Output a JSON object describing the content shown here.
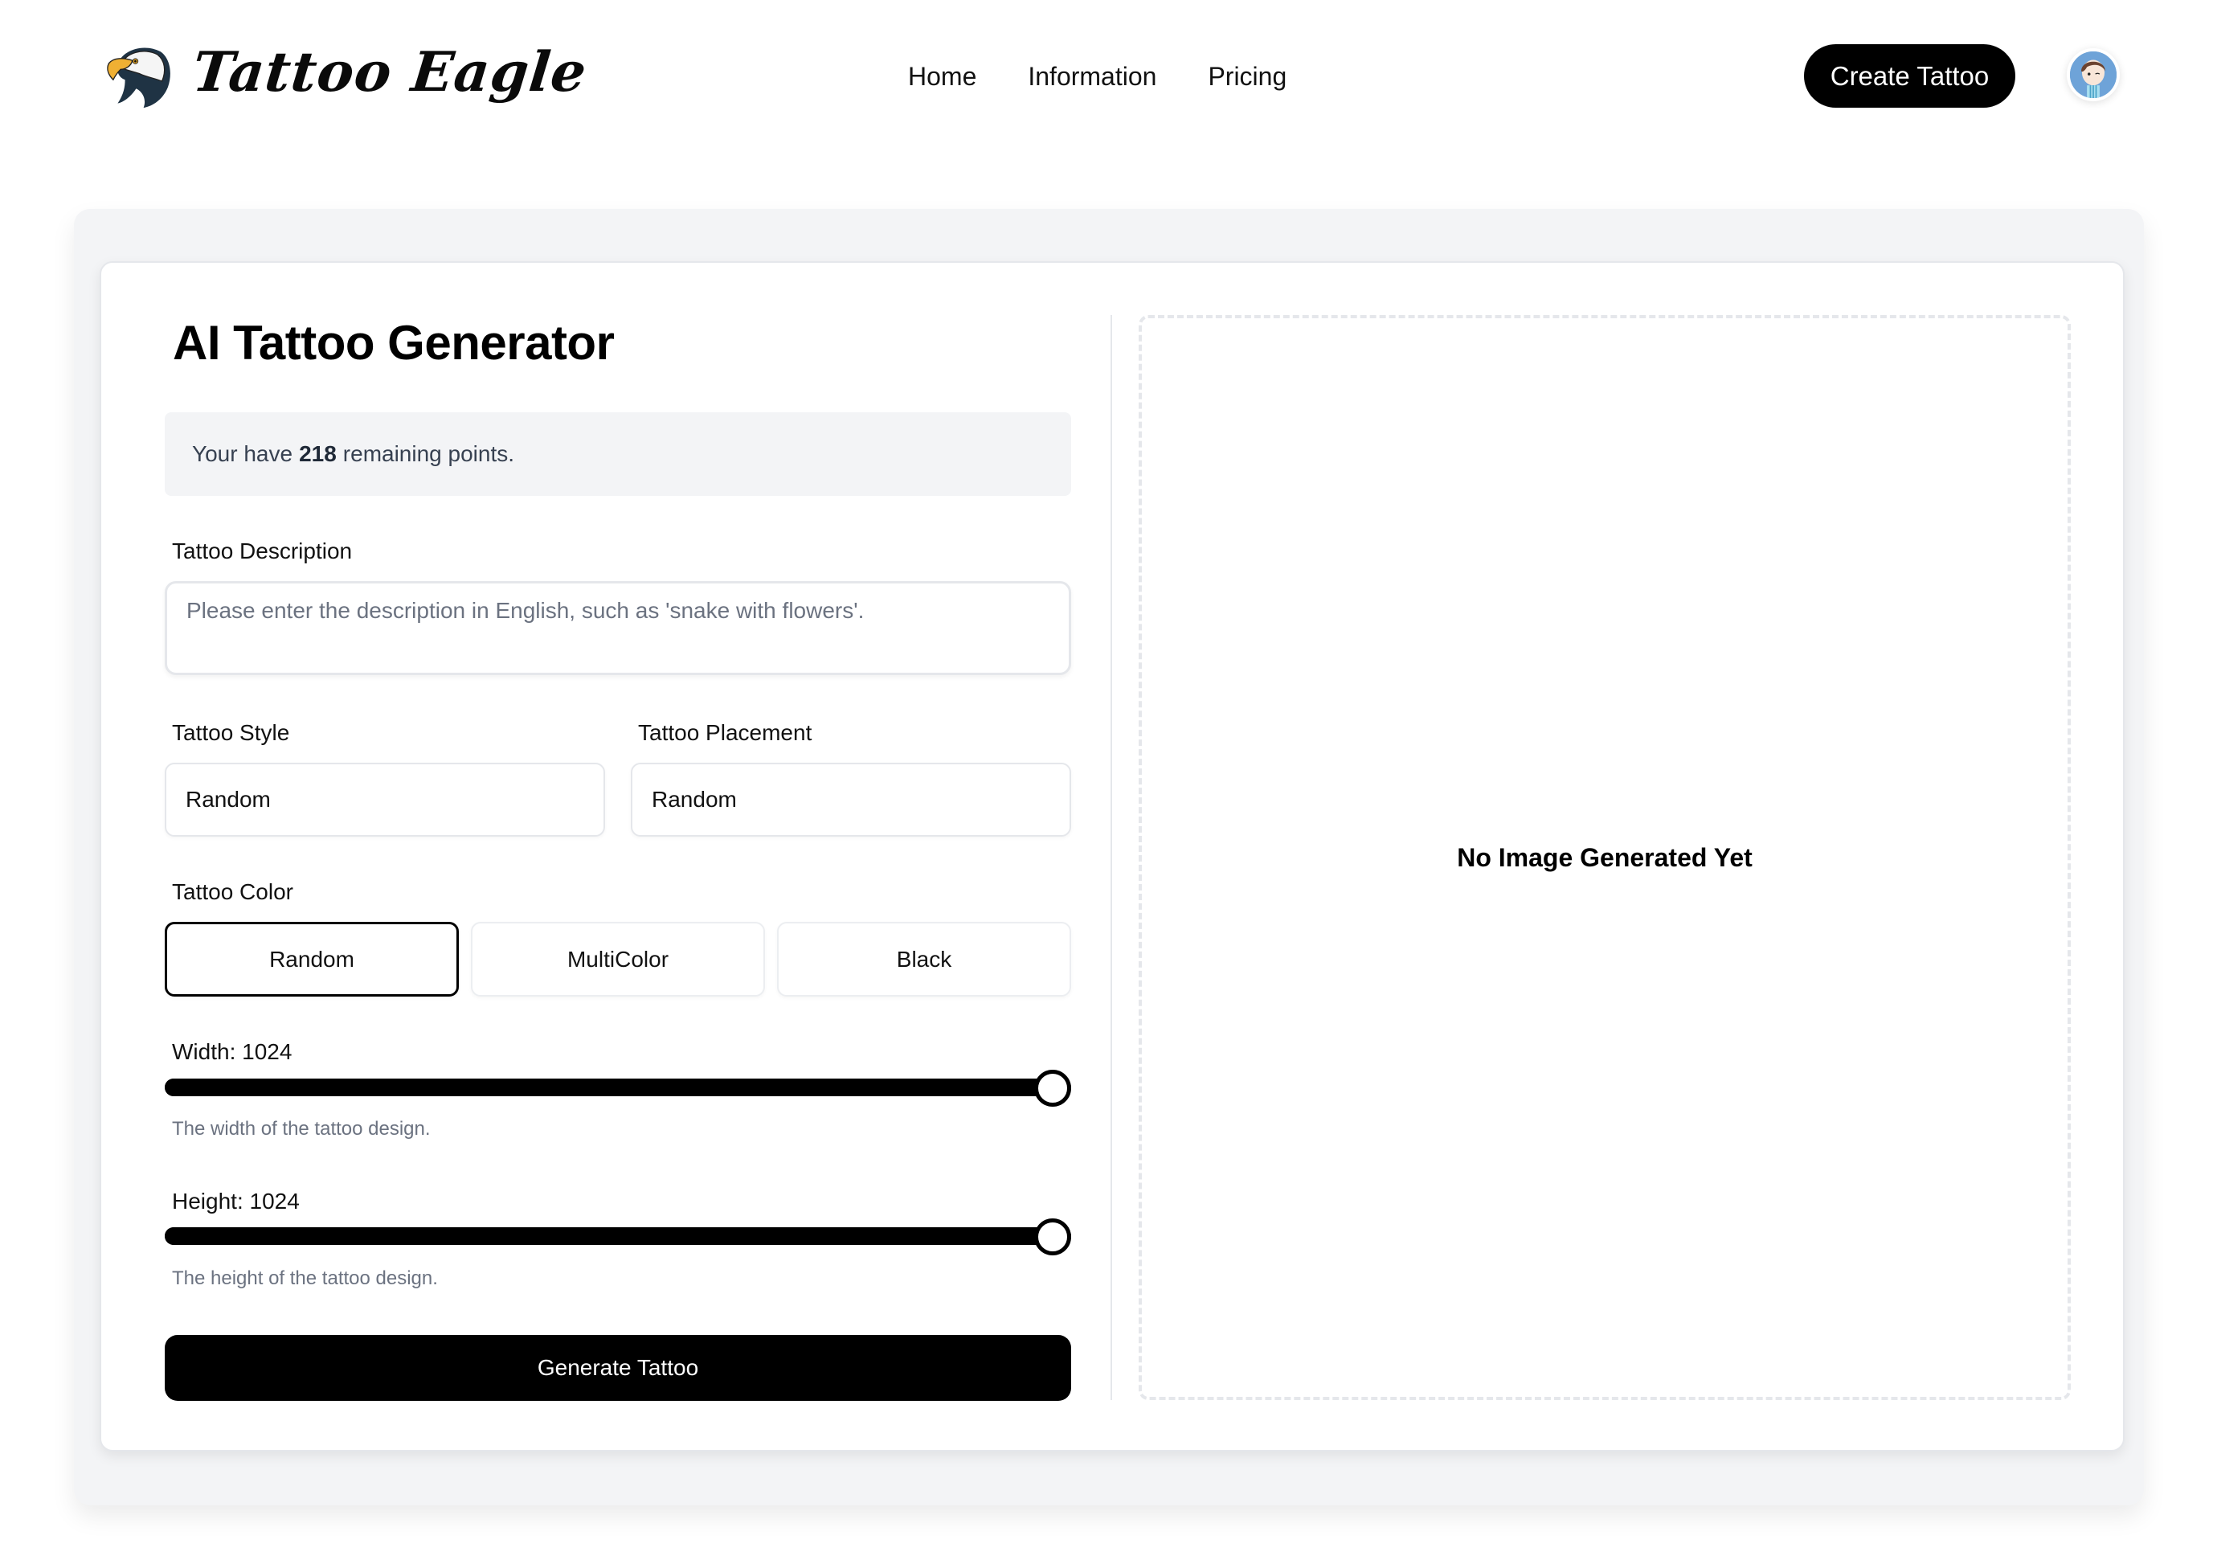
{
  "header": {
    "brand": "Tattoo Eagle",
    "nav": [
      {
        "label": "Home"
      },
      {
        "label": "Information"
      },
      {
        "label": "Pricing"
      }
    ],
    "cta_label": "Create Tattoo",
    "avatar_icon": "user-avatar"
  },
  "generator": {
    "title": "AI Tattoo Generator",
    "points": {
      "prefix": "Your have",
      "value": "218",
      "suffix": "remaining points."
    },
    "description": {
      "label": "Tattoo Description",
      "value": "",
      "placeholder": "Please enter the description in English, such as 'snake with flowers'."
    },
    "style": {
      "label": "Tattoo Style",
      "value": "Random"
    },
    "placement": {
      "label": "Tattoo Placement",
      "value": "Random"
    },
    "color": {
      "label": "Tattoo Color",
      "options": [
        {
          "label": "Random",
          "selected": true
        },
        {
          "label": "MultiColor",
          "selected": false
        },
        {
          "label": "Black",
          "selected": false
        }
      ]
    },
    "width": {
      "label": "Width: 1024",
      "value": 1024,
      "fraction": 1.0,
      "hint": "The width of the tattoo design."
    },
    "height": {
      "label": "Height: 1024",
      "value": 1024,
      "fraction": 1.0,
      "hint": "The height of the tattoo design."
    },
    "generate_label": "Generate Tattoo"
  },
  "preview": {
    "empty_text": "No Image Generated Yet"
  },
  "colors": {
    "primary": "#000000",
    "background": "#ffffff",
    "panel": "#f3f4f6",
    "border": "#e5e7eb",
    "muted_text": "#6b7280",
    "avatar_bg": "#6ea3d8"
  }
}
